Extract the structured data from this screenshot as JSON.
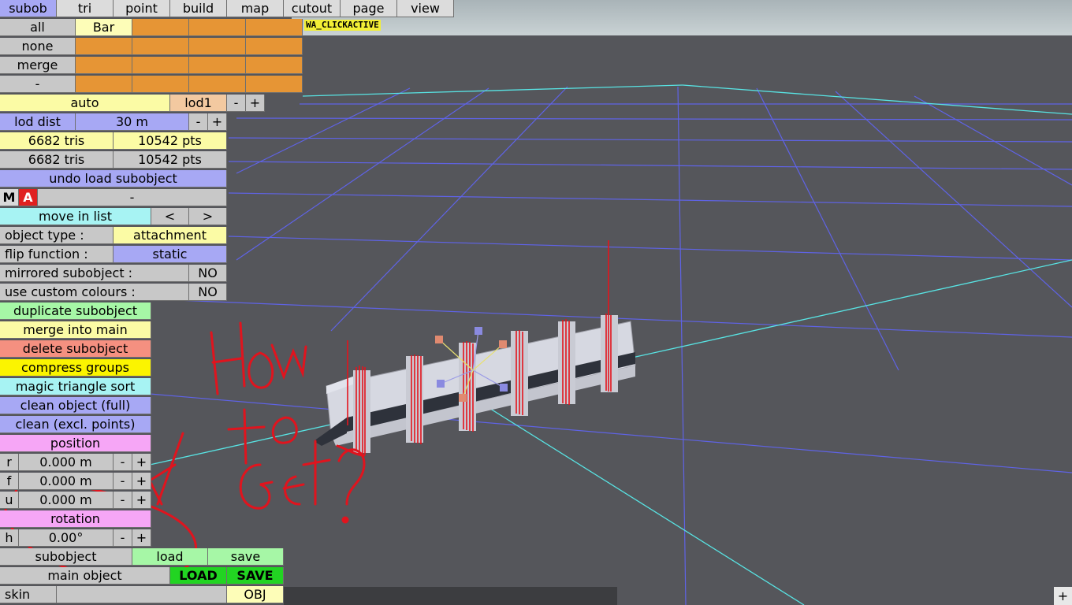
{
  "tabs": [
    "subob",
    "tri",
    "point",
    "build",
    "map",
    "cutout",
    "page",
    "view"
  ],
  "active_tab": "subob",
  "badge": "WA_CLICKACTIVE",
  "select_rows": [
    "all",
    "none",
    "merge",
    "-"
  ],
  "subobject_name": "Bar",
  "lod": {
    "auto": "auto",
    "level": "lod1",
    "minus": "-",
    "plus": "+",
    "dist_label": "lod dist",
    "dist_value": "30 m"
  },
  "stats": {
    "tris1": "6682 tris",
    "pts1": "10542 pts",
    "tris2": "6682 tris",
    "pts2": "10542 pts"
  },
  "undo": "undo load subobject",
  "ma_row": {
    "m": "M",
    "a": "A",
    "value": "-"
  },
  "move_in_list": {
    "label": "move in list",
    "prev": "<",
    "next": ">"
  },
  "object_type": {
    "label": "object type :",
    "value": "attachment"
  },
  "flip_function": {
    "label": "flip function :",
    "value": "static"
  },
  "mirrored": {
    "label": "mirrored subobject :",
    "value": "NO"
  },
  "custom_colours": {
    "label": "use custom colours :",
    "value": "NO"
  },
  "actions": {
    "duplicate": "duplicate subobject",
    "merge_main": "merge into main",
    "delete": "delete subobject",
    "compress": "compress groups",
    "magic": "magic triangle sort",
    "clean_full": "clean object (full)",
    "clean_excl": "clean (excl. points)"
  },
  "position": {
    "title": "position",
    "r_label": "r",
    "r_value": "0.000 m",
    "f_label": "f",
    "f_value": "0.000 m",
    "u_label": "u",
    "u_value": "0.000 m"
  },
  "rotation": {
    "title": "rotation",
    "h_label": "h",
    "h_value": "0.00°"
  },
  "stepper": {
    "minus": "-",
    "plus": "+"
  },
  "file": {
    "subobject": "subobject",
    "load": "load",
    "save": "save",
    "main_object": "main object",
    "LOAD": "LOAD",
    "SAVE": "SAVE",
    "skin": "skin",
    "obj": "OBJ"
  },
  "corner_plus": "+",
  "annotation": {
    "line1": "How",
    "line2": "to",
    "line3": "Get?"
  },
  "colors": {
    "panel_gray": "#c8c8c8",
    "blue": "#a7a8f4",
    "orange": "#e69535",
    "cyan": "#a7f3f3",
    "green": "#a6f7a6",
    "red": "#f59080",
    "yellow": "#fbf400",
    "pink": "#f6a6f6",
    "bright_green": "#22d422",
    "annotation_red": "#e0141e",
    "viewport_bg": "#55565b"
  }
}
